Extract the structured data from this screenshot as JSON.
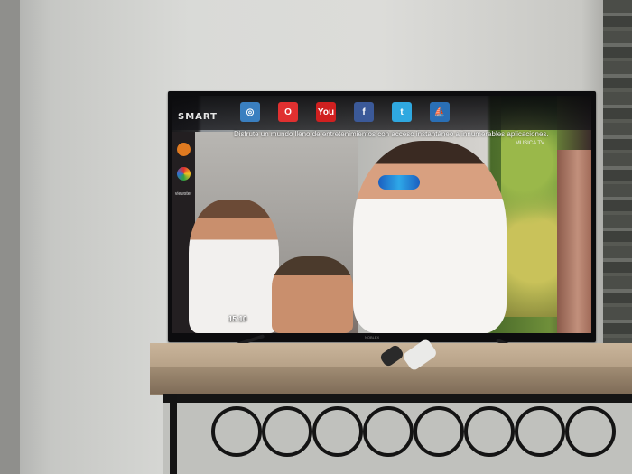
{
  "tv": {
    "brand_label": "SMART",
    "apps": [
      {
        "name": "browser-icon",
        "glyph": "◎",
        "color": "#3a7fc0"
      },
      {
        "name": "apps-icon",
        "glyph": "O",
        "color": "#e03030"
      },
      {
        "name": "youtube-icon",
        "glyph": "You",
        "color": "#d02020"
      },
      {
        "name": "facebook-icon",
        "glyph": "f",
        "color": "#3b5998"
      },
      {
        "name": "twitter-icon",
        "glyph": "t",
        "color": "#2fa8e0"
      },
      {
        "name": "sailboat-icon",
        "glyph": "⛵",
        "color": "#2a6fb5"
      }
    ],
    "marquee": "Disfrute un mundo lleno de entretenimientos con acceso instantáneo a innumerables aplicaciones.",
    "channel_logo": "MUSICA TV",
    "sidebar": [
      {
        "name": "orange-app-icon",
        "color": "#e07a20",
        "label": ""
      },
      {
        "name": "chrome-like-icon",
        "color": "#3a9a4a",
        "label": ""
      },
      {
        "name": "viewster-label",
        "color": "",
        "label": "viewster"
      }
    ],
    "clock": "15:10",
    "maker": "NOBLEX"
  }
}
